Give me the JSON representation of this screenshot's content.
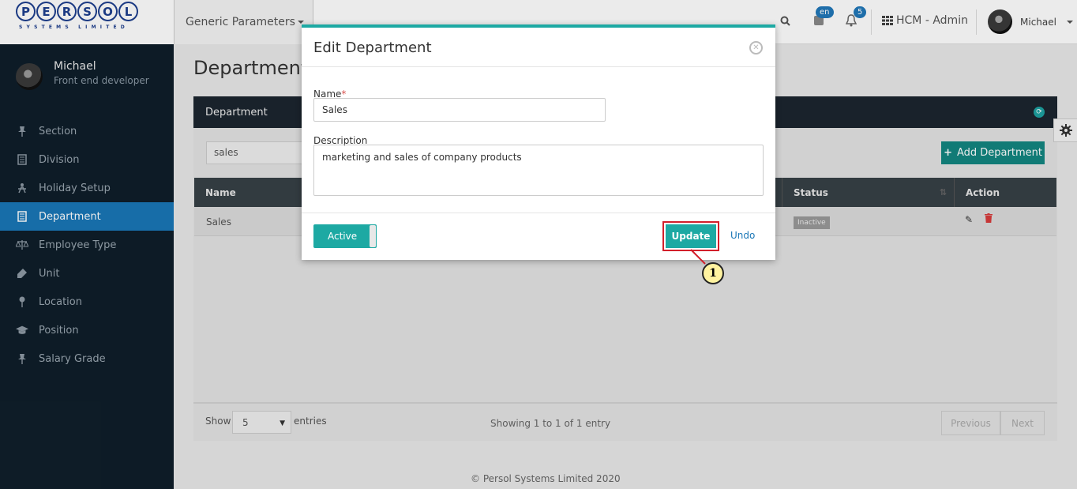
{
  "header": {
    "logo_text": "PERSOL",
    "logo_subtext": "SYSTEMS LIMITED",
    "module_dropdown": "Generic Parameters",
    "lang_badge": "en",
    "notif_count": "5",
    "app_name": "HCM - Admin",
    "user_name": "Michael"
  },
  "sidebar": {
    "user_name": "Michael",
    "user_role": "Front end developer",
    "items": [
      {
        "label": "Section",
        "icon": "pin-icon"
      },
      {
        "label": "Division",
        "icon": "document-icon"
      },
      {
        "label": "Holiday Setup",
        "icon": "person-icon"
      },
      {
        "label": "Department",
        "icon": "document-icon",
        "active": true
      },
      {
        "label": "Employee Type",
        "icon": "scale-icon"
      },
      {
        "label": "Unit",
        "icon": "tag-icon"
      },
      {
        "label": "Location",
        "icon": "map-pin-icon"
      },
      {
        "label": "Position",
        "icon": "graduation-cap-icon"
      },
      {
        "label": "Salary Grade",
        "icon": "pin-icon"
      }
    ]
  },
  "main": {
    "page_title": "Department",
    "panel_title": "Department",
    "filter_value": "sales",
    "add_button": "Add Department",
    "table": {
      "columns": [
        "Name",
        "Status",
        "Action"
      ],
      "rows": [
        {
          "name": "Sales",
          "status": "Inactive"
        }
      ]
    },
    "show_label": "Show",
    "page_size": "5",
    "entries_label": "entries",
    "info": "Showing 1 to 1 of 1 entry",
    "prev": "Previous",
    "next": "Next",
    "footer": "© Persol Systems Limited 2020"
  },
  "modal": {
    "title": "Edit Department",
    "name_label": "Name",
    "name_required": "*",
    "name_value": "Sales",
    "desc_label": "Description",
    "desc_value": "marketing and sales of company products",
    "toggle_label": "Active",
    "update_label": "Update",
    "undo_label": "Undo"
  },
  "callout": {
    "number": "1"
  },
  "colors": {
    "accent": "#1da9a3",
    "sidebar_bg": "#0f1e2a",
    "active_item": "#1a77b7",
    "highlight": "#d21f2b"
  }
}
